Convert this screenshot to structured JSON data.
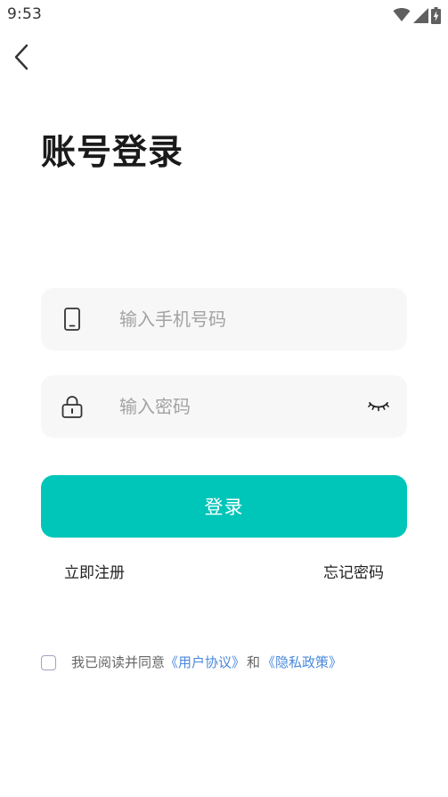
{
  "status_bar": {
    "time": "9:53",
    "icons": [
      "wifi-icon",
      "signal-icon",
      "battery-charging-icon"
    ]
  },
  "header": {
    "back_icon": "chevron-left-icon"
  },
  "page": {
    "title": "账号登录"
  },
  "form": {
    "phone": {
      "icon": "phone-icon",
      "placeholder": "输入手机号码",
      "value": ""
    },
    "password": {
      "icon": "lock-icon",
      "placeholder": "输入密码",
      "value": "",
      "toggle_icon": "eye-closed-icon"
    },
    "login_label": "登录"
  },
  "links": {
    "register": "立即注册",
    "forgot_password": "忘记密码"
  },
  "agreement": {
    "checked": false,
    "prefix": "我已阅读并同意",
    "user_agreement": "《用户协议》",
    "and": "和",
    "privacy_policy": "《隐私政策》"
  },
  "colors": {
    "accent": "#00c5b9",
    "link": "#4a89dc",
    "field_bg": "#f7f7f7",
    "placeholder": "#a3a3a3",
    "text_dark": "#1a1a1a",
    "checkbox_border": "#9ea3c0"
  }
}
